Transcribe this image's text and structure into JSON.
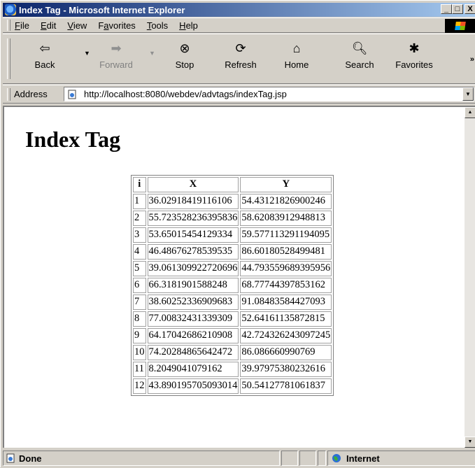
{
  "window": {
    "title": "Index Tag - Microsoft Internet Explorer",
    "min_label": "_",
    "max_label": "□",
    "close_label": "X"
  },
  "menu": {
    "items": [
      {
        "pre": "",
        "u": "F",
        "post": "ile"
      },
      {
        "pre": "",
        "u": "E",
        "post": "dit"
      },
      {
        "pre": "",
        "u": "V",
        "post": "iew"
      },
      {
        "pre": "F",
        "u": "a",
        "post": "vorites"
      },
      {
        "pre": "",
        "u": "T",
        "post": "ools"
      },
      {
        "pre": "",
        "u": "H",
        "post": "elp"
      }
    ]
  },
  "toolbar": {
    "back": "Back",
    "forward": "Forward",
    "stop": "Stop",
    "refresh": "Refresh",
    "home": "Home",
    "search": "Search",
    "favorites": "Favorites",
    "more": "»"
  },
  "address": {
    "label": "Address",
    "url": "http://localhost:8080/webdev/advtags/indexTag.jsp"
  },
  "page": {
    "heading": "Index Tag",
    "table": {
      "headers": [
        "i",
        "X",
        "Y"
      ],
      "rows": [
        [
          "1",
          "36.02918419116106",
          "54.43121826900246"
        ],
        [
          "2",
          "55.723528236395836",
          "58.62083912948813"
        ],
        [
          "3",
          "53.65015454129334",
          "59.577113291194095"
        ],
        [
          "4",
          "46.48676278539535",
          "86.60180528499481"
        ],
        [
          "5",
          "39.061309922720696",
          "44.793559689395956"
        ],
        [
          "6",
          "66.3181901588248",
          "68.77744397853162"
        ],
        [
          "7",
          "38.60252336909683",
          "91.08483584427093"
        ],
        [
          "8",
          "77.00832431339309",
          "52.64161135872815"
        ],
        [
          "9",
          "64.17042686210908",
          "42.724326243097245"
        ],
        [
          "10",
          "74.20284865642472",
          "86.086660990769"
        ],
        [
          "11",
          "8.2049041079162",
          "39.97975380232616"
        ],
        [
          "12",
          "43.890195705093014",
          "50.54127781061837"
        ]
      ]
    }
  },
  "status": {
    "text": "Done",
    "zone": "Internet"
  }
}
